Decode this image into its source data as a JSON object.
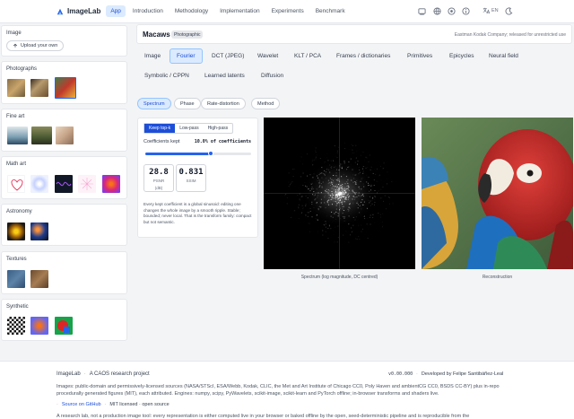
{
  "app": {
    "name": "ImageLab"
  },
  "nav": {
    "items": [
      "App",
      "Introduction",
      "Methodology",
      "Implementation",
      "Experiments",
      "Benchmark"
    ],
    "active": "App"
  },
  "topbar": {
    "lang_label": "EN",
    "icons": [
      "github-icon",
      "globe-icon",
      "eye-icon",
      "info-icon",
      "translate-icon",
      "moon-icon"
    ]
  },
  "sidebar": {
    "image": {
      "title": "Image",
      "upload_label": "Upload your own"
    },
    "sections": [
      {
        "title": "Photographs",
        "thumbs": 3
      },
      {
        "title": "Fine art",
        "thumbs": 3
      },
      {
        "title": "Math art",
        "thumbs": 5
      },
      {
        "title": "Astronomy",
        "thumbs": 2
      },
      {
        "title": "Textures",
        "thumbs": 2
      },
      {
        "title": "Synthetic",
        "thumbs": 3
      }
    ]
  },
  "header": {
    "title": "Macaws",
    "badge": "Photographic",
    "credit": "Eastman Kodak Company; released for unrestricted use"
  },
  "tabs": {
    "row1": [
      "Image",
      "Fourier",
      "DCT (JPEG)",
      "Wavelet",
      "KLT / PCA",
      "Frames / dictionaries",
      "Primitives",
      "Epicycles",
      "Neural field"
    ],
    "row2": [
      "Symbolic / CPPN",
      "Learned latents",
      "Diffusion"
    ],
    "active": "Fourier"
  },
  "subtabs": {
    "items": [
      "Spectrum",
      "Phase",
      "Rate-distortion",
      "Method"
    ],
    "active": "Spectrum"
  },
  "controls": {
    "modes": [
      "Keep top-k",
      "Low-pass",
      "High-pass"
    ],
    "active_mode": "Keep top-k",
    "kept_label": "Coefficients kept",
    "kept_value": "10.0% of coefficients",
    "kept_fraction": 0.62,
    "psnr": {
      "value": "28.8",
      "label": "PSNR",
      "unit": "(dB)"
    },
    "ssim": {
      "value": "0.831",
      "label": "SSIM"
    },
    "description": "Every kept coefficient is a global sinusoid: editing one changes the whole image by a smooth ripple. Stable; bounded; never local. That is the transform family: compact but not semantic."
  },
  "panels": {
    "spectrum_caption": "Spectrum (log magnitude, DC centred)",
    "reconstruction_caption": "Reconstruction"
  },
  "footer": {
    "brand": "ImageLab",
    "tagline": "A CAOS research project",
    "version": "v0.00.000",
    "developer": "Developed by Felipe Santibáñez-Leal",
    "credits": "Images: public-domain and permissively-licensed sources (NASA/STScI, ESA/Webb, Kodak, CLIC, the Met and Art Institute of Chicago CC0, Poly Haven and ambientCG CC0, BSDS CC-BY) plus in-repo procedurally generated figures (MIT), each attributed. Engines: numpy, scipy, PyWavelets, scikit-image, scikit-learn and PyTorch offline; in-browser transforms and shaders live.",
    "source_link": "Source on GitHub",
    "license": "MIT licensed · open source",
    "note": "A research lab, not a production image tool: every representation is either computed live in your browser or baked offline by the open, seed-deterministic pipeline and is reproducible from the"
  }
}
